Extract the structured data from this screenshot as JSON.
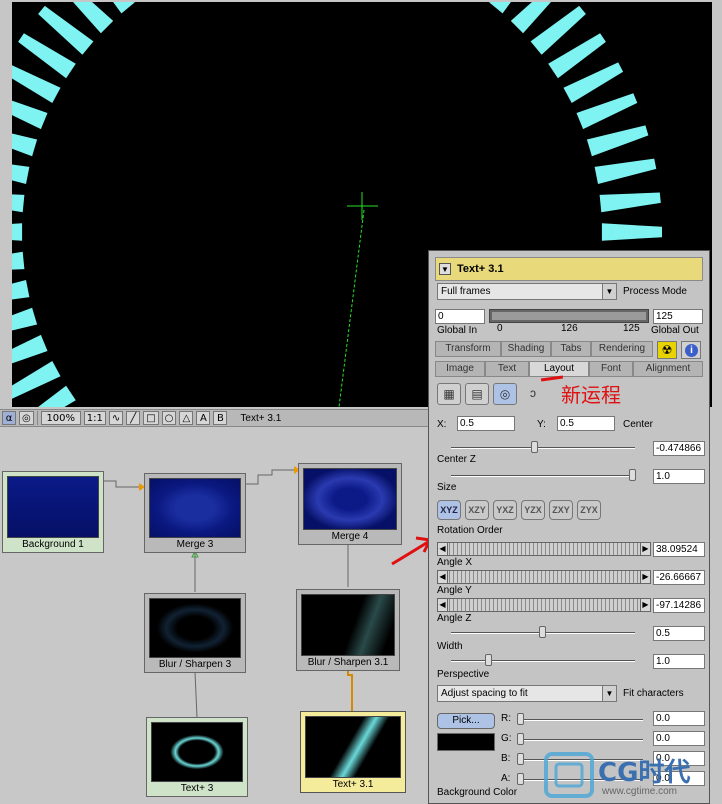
{
  "viewer": {
    "toolbar": {
      "zoom": "100%",
      "ratio": "1:1",
      "a_btn": "A",
      "b_btn": "B",
      "tool_label": "Text+ 3.1"
    }
  },
  "flow": {
    "nodes": [
      {
        "label": "Background 1"
      },
      {
        "label": "Merge 3"
      },
      {
        "label": "Merge 4"
      },
      {
        "label": "Blur / Sharpen 3"
      },
      {
        "label": "Blur / Sharpen 3.1"
      },
      {
        "label": "Text+ 3"
      },
      {
        "label": "Text+ 3.1"
      }
    ]
  },
  "panel": {
    "title": "Text+ 3.1",
    "process_select": "Full frames",
    "process_label": "Process Mode",
    "global_in": "0",
    "global_out": "125",
    "global_in_label": "Global In",
    "global_out_label": "Global Out",
    "range_ticks": [
      "0",
      "126",
      "125"
    ],
    "tabs_row1": [
      "Transform",
      "Shading",
      "Tabs",
      "Rendering"
    ],
    "tabs_row2": [
      "Image",
      "Text",
      "Layout",
      "Font",
      "Alignment"
    ],
    "annotation": "新运程",
    "x_label": "X:",
    "x_value": "0.5",
    "y_label": "Y:",
    "y_value": "0.5",
    "center_label": "Center",
    "centerz_value": "-0.474866",
    "centerz_label": "Center Z",
    "size_value": "1.0",
    "size_label": "Size",
    "orders": [
      "XYZ",
      "XZY",
      "YXZ",
      "YZX",
      "ZXY",
      "ZYX"
    ],
    "rotation_order_label": "Rotation Order",
    "angle_x_value": "38.09524",
    "angle_x_label": "Angle X",
    "angle_y_value": "-26.66667",
    "angle_y_label": "Angle Y",
    "angle_z_value": "-97.14286",
    "angle_z_label": "Angle Z",
    "width_value": "0.5",
    "width_label": "Width",
    "perspective_value": "1.0",
    "perspective_label": "Perspective",
    "spacing_select": "Adjust spacing to fit",
    "fit_label": "Fit characters",
    "pick_label": "Pick...",
    "r_label": "R:",
    "g_label": "G:",
    "b_label": "B:",
    "a_label": "A:",
    "r_value": "0.0",
    "g_value": "0.0",
    "b_value": "0.0",
    "a_value": "0.0",
    "bg_color_label": "Background Color"
  },
  "watermark": {
    "brand": "CG时代",
    "url": "www.cgtime.com"
  },
  "colors": {
    "accent_cyan": "#7ff2f2",
    "title_bar": "#e8d97a",
    "annotation_red": "#e01010"
  }
}
